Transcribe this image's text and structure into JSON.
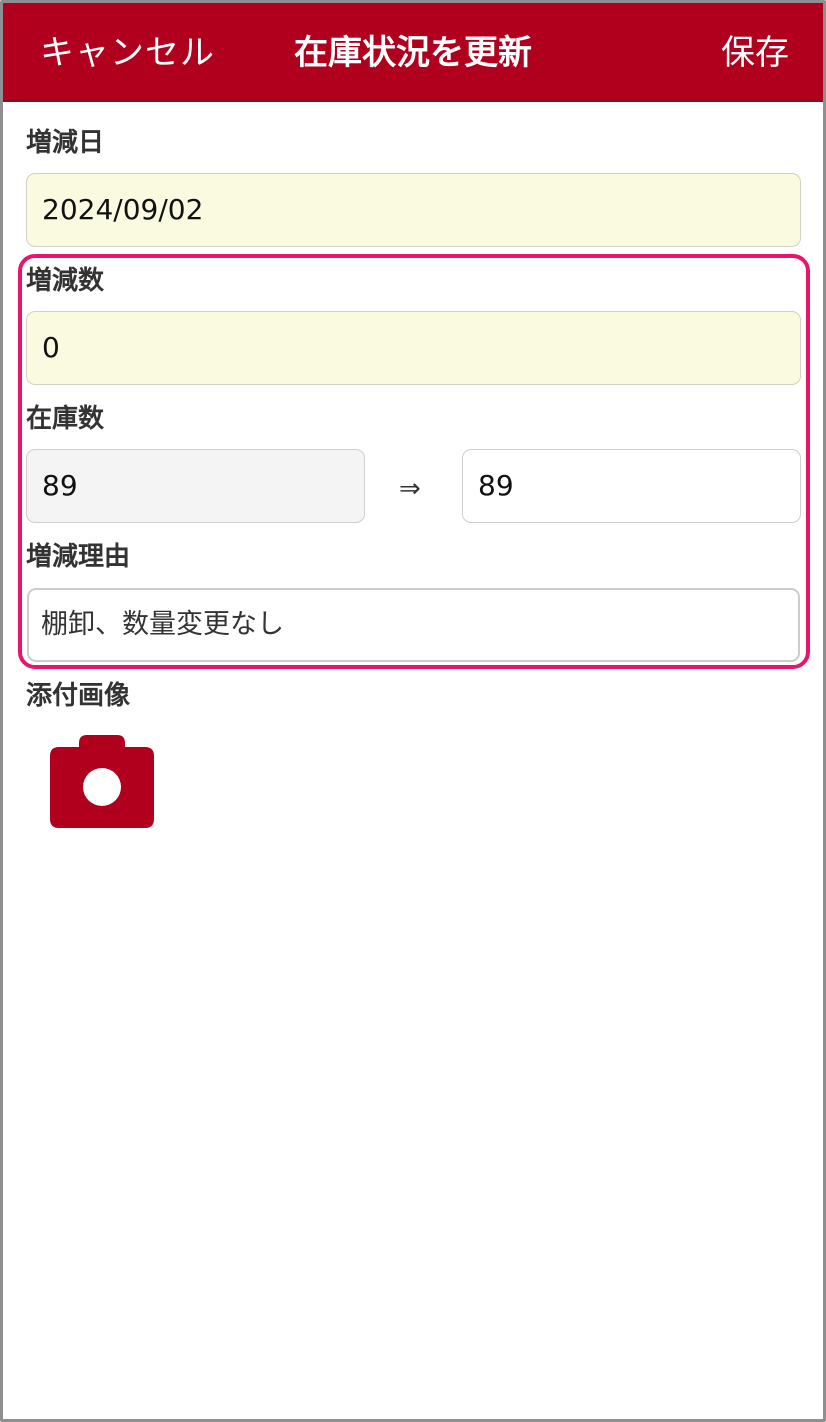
{
  "navbar": {
    "cancel_label": "キャンセル",
    "title": "在庫状況を更新",
    "save_label": "保存"
  },
  "form": {
    "date": {
      "label": "増減日",
      "value": "2024/09/02"
    },
    "change": {
      "label": "増減数",
      "value": "0"
    },
    "stock": {
      "label": "在庫数",
      "current": "89",
      "arrow": "⇒",
      "new": "89"
    },
    "reason": {
      "label": "増減理由",
      "value": "棚卸、数量変更なし"
    },
    "attachment": {
      "label": "添付画像",
      "icon": "camera-icon"
    }
  },
  "colors": {
    "accent": "#b0001e",
    "input_highlight": "#fafae0",
    "annotation_border": "#e8156e"
  }
}
